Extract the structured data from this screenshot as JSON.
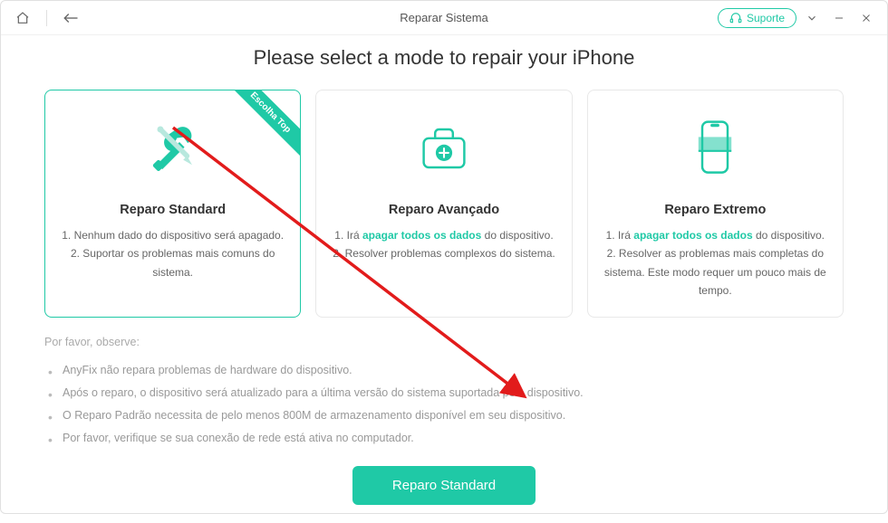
{
  "titlebar": {
    "title": "Reparar Sistema",
    "support_label": "Suporte"
  },
  "heading": "Please select a mode to repair your iPhone",
  "cards": {
    "standard": {
      "ribbon": "Escolha Top",
      "title": "Reparo Standard",
      "line1": "1. Nenhum dado do dispositivo será apagado.",
      "line2": "2. Suportar os problemas mais comuns do sistema."
    },
    "advanced": {
      "title": "Reparo Avançado",
      "line1_pre": "1. Irá ",
      "line1_hl": "apagar todos os dados",
      "line1_post": " do dispositivo.",
      "line2": "2. Resolver problemas complexos do sistema."
    },
    "extreme": {
      "title": "Reparo Extremo",
      "line1_pre": "1. Irá ",
      "line1_hl": "apagar todos os dados",
      "line1_post": " do dispositivo.",
      "line2": "2. Resolver as problemas mais completas do sistema. Este modo requer um pouco mais de tempo."
    }
  },
  "notes_title": "Por favor, observe:",
  "notes": {
    "n1": "AnyFix não repara problemas de hardware do dispositivo.",
    "n2": "Após o reparo, o dispositivo será atualizado para a última versão do sistema suportada pelo dispositivo.",
    "n3": "O Reparo Padrão necessita de pelo menos 800M de armazenamento disponível em seu dispositivo.",
    "n4": "Por favor, verifique se sua conexão de rede está ativa no computador."
  },
  "cta_label": "Reparo Standard"
}
